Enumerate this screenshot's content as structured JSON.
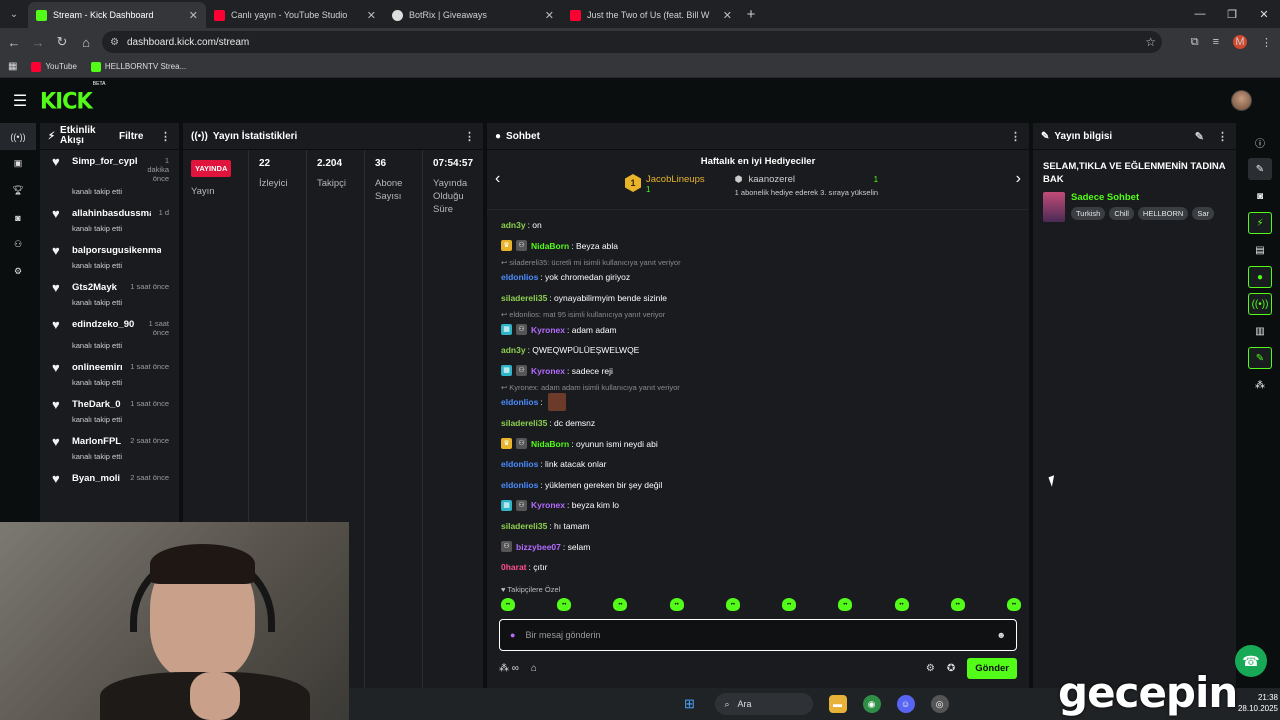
{
  "browser": {
    "tabs": [
      {
        "title": "Stream - Kick Dashboard",
        "color": "#53fc18"
      },
      {
        "title": "Canlı yayın - YouTube Studio",
        "color": "#ff0033"
      },
      {
        "title": "BotRix | Giveaways",
        "color": "#dddddd"
      },
      {
        "title": "Just the Two of Us (feat. Bill W",
        "color": "#ff0033"
      }
    ],
    "url": "dashboard.kick.com/stream",
    "bookmarks": [
      {
        "label": "YouTube",
        "color": "#ff0033"
      },
      {
        "label": "HELLBORNTV Strea...",
        "color": "#53fc18"
      }
    ],
    "profile_initial": "M"
  },
  "kick": {
    "logo": "KICK",
    "beta": "BETA"
  },
  "activity": {
    "title": "Etkinlik Akışı",
    "filter": "Filtre",
    "items": [
      {
        "name": "Simp_for_cypher",
        "time": "1 dakika önce",
        "sub": "kanalı takip etti"
      },
      {
        "name": "allahinbasdussmani1",
        "time": "1 d",
        "sub": "kanalı takip etti"
      },
      {
        "name": "balporsugusikenmayr",
        "time": "",
        "sub": "kanalı takip etti"
      },
      {
        "name": "Gts2Mayk",
        "time": "1 saat önce",
        "sub": "kanalı takip etti"
      },
      {
        "name": "edindzeko_90",
        "time": "1 saat önce",
        "sub": "kanalı takip etti"
      },
      {
        "name": "onlineemirr",
        "time": "1 saat önce",
        "sub": "kanalı takip etti"
      },
      {
        "name": "TheDark_0",
        "time": "1 saat önce",
        "sub": "kanalı takip etti"
      },
      {
        "name": "MarlonFPL",
        "time": "2 saat önce",
        "sub": "kanalı takip etti"
      },
      {
        "name": "Byan_moli",
        "time": "2 saat önce",
        "sub": ""
      }
    ]
  },
  "stats": {
    "title": "Yayın İstatistikleri",
    "badge": "YAYINDA",
    "columns": [
      {
        "value": "",
        "label": "Yayın"
      },
      {
        "value": "22",
        "label": "İzleyici"
      },
      {
        "value": "2.204",
        "label": "Takipçi"
      },
      {
        "value": "36",
        "label": "Abone Sayısı"
      },
      {
        "value": "07:54:57",
        "label": "Yayında Olduğu Süre"
      }
    ]
  },
  "chat": {
    "title": "Sohbet",
    "gifters_title": "Haftalık en iyi Hediyeciler",
    "gifter1": {
      "rank": "1",
      "name": "JacobLineups",
      "count": "1"
    },
    "gifter2": {
      "name": "kaanozerel",
      "count": "1",
      "desc": "1 abonelik hediye ederek 3. sıraya yükselin"
    },
    "messages": [
      {
        "user": "adn3y",
        "color": "#8fd14f",
        "text": ": on"
      },
      {
        "user": "NidaBorn",
        "color": "#53fc18",
        "text": ": Beyza abla",
        "badge": "crown"
      },
      {
        "reply": "siladereli35: ücretli mi isimli kullanıcıya yanıt veriyor"
      },
      {
        "user": "eldonlios",
        "color": "#4a8dff",
        "text": ": yok chromedan giriyoz"
      },
      {
        "user": "siladereli35",
        "color": "#8fd14f",
        "text": ": oynayabilirmyim bende sizinle"
      },
      {
        "reply": "eldonlios: mat 95 isimli kullanıcıya yanıt veriyor"
      },
      {
        "user": "Kyronex",
        "color": "#b46cff",
        "text": ": adam adam",
        "badge": "sub"
      },
      {
        "user": "adn3y",
        "color": "#8fd14f",
        "text": ": QWEQWPÜLÜEŞWELWQE"
      },
      {
        "user": "Kyronex",
        "color": "#b46cff",
        "text": ": sadece reji",
        "badge": "sub"
      },
      {
        "reply": "Kyronex: adam adam isimli kullanıcıya yanıt veriyor"
      },
      {
        "user": "eldonlios",
        "color": "#4a8dff",
        "text": ":"
      },
      {
        "user": "siladereli35",
        "color": "#8fd14f",
        "text": ": dc demsnz"
      },
      {
        "user": "NidaBorn",
        "color": "#53fc18",
        "text": ": oyunun ismi neydi abi",
        "badge": "crown"
      },
      {
        "user": "eldonlios",
        "color": "#4a8dff",
        "text": ": link atacak onlar"
      },
      {
        "user": "eldonlios",
        "color": "#4a8dff",
        "text": ": yüklemen gereken bir şey değil"
      },
      {
        "user": "Kyronex",
        "color": "#b46cff",
        "text": ": beyza kim lo",
        "badge": "sub"
      },
      {
        "user": "siladereli35",
        "color": "#8fd14f",
        "text": ": hı tamam"
      },
      {
        "user": "bizzybee07",
        "color": "#b46cff",
        "text": ": selam",
        "badge": "mod"
      },
      {
        "user": "0harat",
        "color": "#ff4f8b",
        "text": ": çıtır"
      }
    ],
    "followers_only": "Takipçilere Özel",
    "placeholder": "Bir mesaj gönderin",
    "send": "Gönder"
  },
  "info": {
    "title": "Yayın bilgisi",
    "stream_title": "SELAM,TIKLA VE EĞLENMENİN TADINA BAK",
    "category": "Sadece Sohbet",
    "tags": [
      "Turkish",
      "Chill",
      "HELLBORN",
      "Sar"
    ]
  },
  "taskbar": {
    "search": "Ara",
    "time": "21:38",
    "date": "28.10.2025"
  },
  "watermark": "gecepin"
}
